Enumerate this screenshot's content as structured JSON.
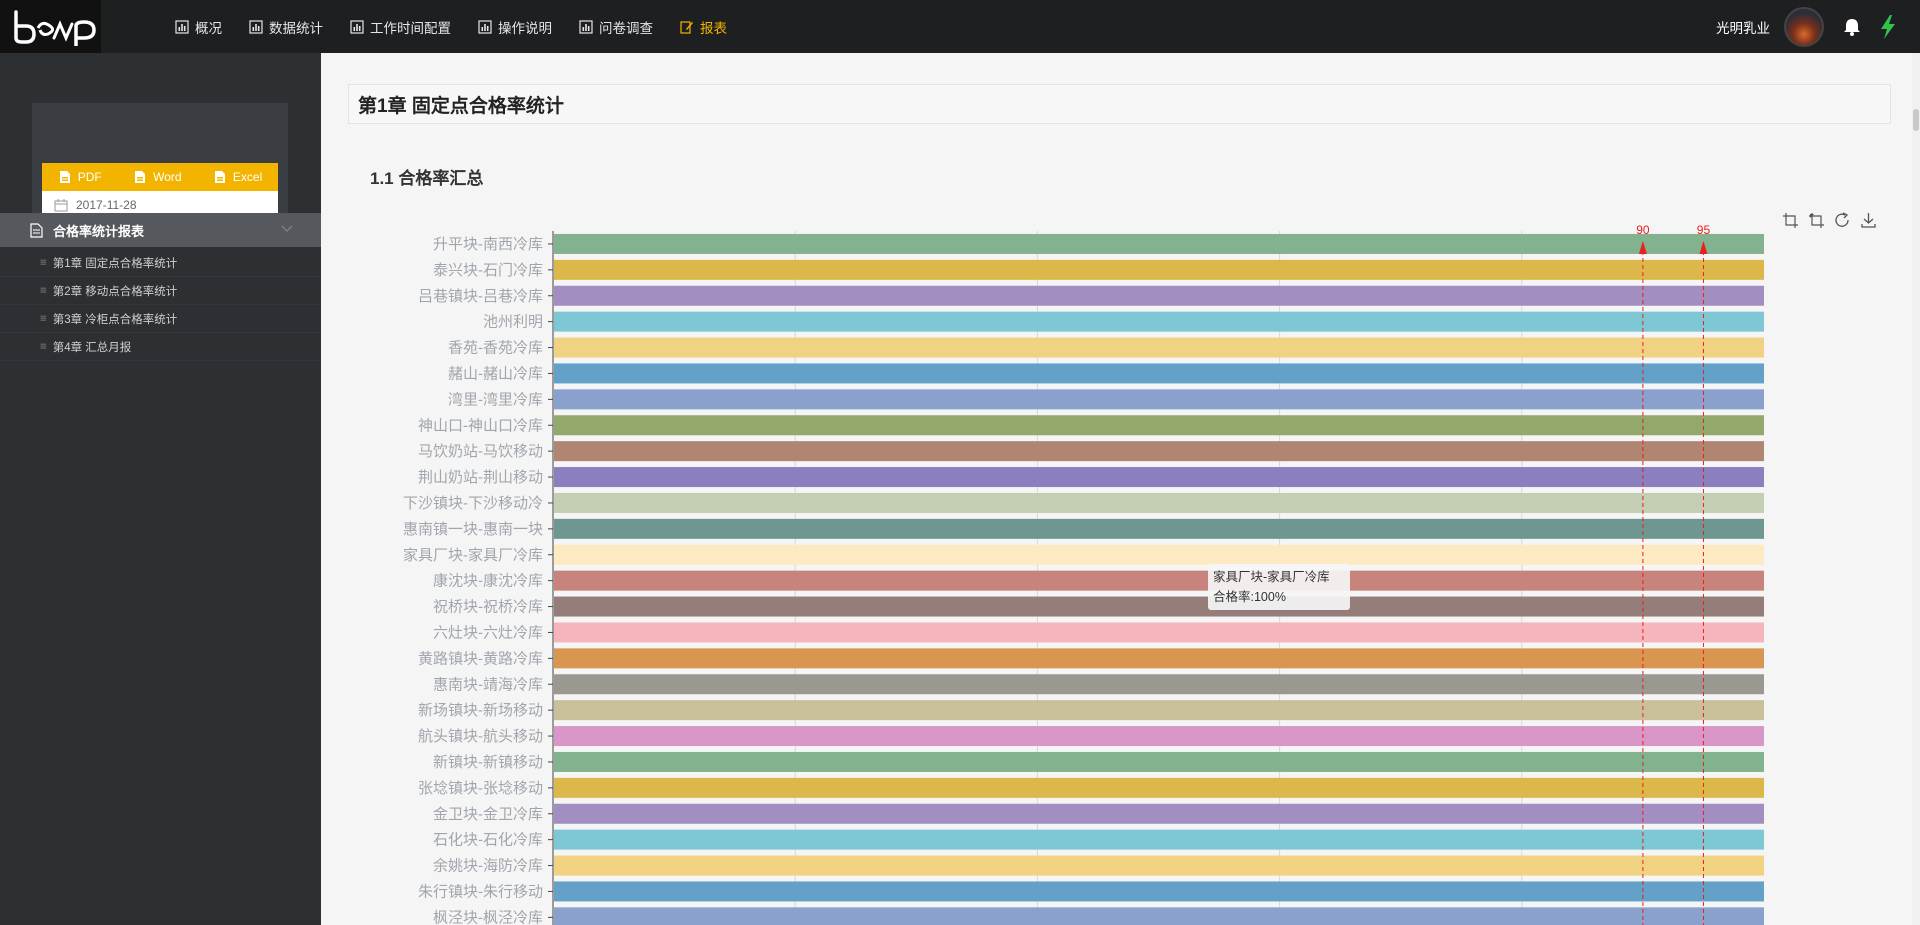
{
  "topbar": {
    "nav": [
      {
        "label": "概况",
        "icon": "chart-icon",
        "active": false
      },
      {
        "label": "数据统计",
        "icon": "chart-icon",
        "active": false
      },
      {
        "label": "工作时间配置",
        "icon": "chart-icon",
        "active": false
      },
      {
        "label": "操作说明",
        "icon": "chart-icon",
        "active": false
      },
      {
        "label": "问卷调查",
        "icon": "chart-icon",
        "active": false
      },
      {
        "label": "报表",
        "icon": "edit-icon",
        "active": true
      }
    ],
    "user_name": "光明乳业",
    "accent": "#f3b400"
  },
  "sidebar": {
    "export": {
      "pdf": "PDF",
      "word": "Word",
      "excel": "Excel"
    },
    "date": "2017-11-28",
    "menu_title": "合格率统计报表",
    "items": [
      {
        "label": "第1章 固定点合格率统计"
      },
      {
        "label": "第2章 移动点合格率统计"
      },
      {
        "label": "第3章 冷柜点合格率统计"
      },
      {
        "label": "第4章 汇总月报"
      }
    ]
  },
  "main": {
    "chapter_title": "第1章 固定点合格率统计",
    "section_title": "1.1 合格率汇总",
    "tooltip": {
      "title": "家具厂块-家具厂冷库",
      "value": "合格率:100%"
    }
  },
  "chart_data": {
    "type": "bar",
    "orientation": "horizontal",
    "categories": [
      "升平块-南西冷库",
      "泰兴块-石门冷库",
      "吕巷镇块-吕巷冷库",
      "池州利明",
      "香苑-香苑冷库",
      "赭山-赭山冷库",
      "湾里-湾里冷库",
      "神山口-神山口冷库",
      "马饮奶站-马饮移动",
      "荆山奶站-荆山移动",
      "下沙镇块-下沙移动冷",
      "惠南镇一块-惠南一块",
      "家具厂块-家具厂冷库",
      "康沈块-康沈冷库",
      "祝桥块-祝桥冷库",
      "六灶块-六灶冷库",
      "黄路镇块-黄路冷库",
      "惠南块-靖海冷库",
      "新场镇块-新场移动",
      "航头镇块-航头移动",
      "新镇块-新镇移动",
      "张埝镇块-张埝移动",
      "金卫块-金卫冷库",
      "石化块-石化冷库",
      "余姚块-海防冷库",
      "朱行镇块-朱行移动",
      "枫泾块-枫泾冷库"
    ],
    "values": [
      100,
      100,
      100,
      100,
      100,
      100,
      100,
      100,
      100,
      100,
      100,
      100,
      100,
      100,
      100,
      100,
      100,
      100,
      100,
      100,
      100,
      100,
      100,
      100,
      100,
      100,
      100
    ],
    "colors": [
      "#82b28e",
      "#dcb84a",
      "#a28ec0",
      "#7ec8d6",
      "#f1d283",
      "#63a1c8",
      "#8aa1cd",
      "#93a86b",
      "#b08672",
      "#8b7fbf",
      "#c3ceb3",
      "#6f9791",
      "#fde9c2",
      "#c8847c",
      "#957d7a",
      "#f6b5bd",
      "#d99650",
      "#9b9891",
      "#c9bf9b",
      "#d996c8",
      "#82b28e",
      "#dcb84a",
      "#a28ec0",
      "#7ec8d6",
      "#f1d283",
      "#63a1c8",
      "#8aa1cd"
    ],
    "markLines": [
      90,
      95
    ],
    "markLineColor": "#e8211d",
    "xlim": [
      0,
      100
    ],
    "gridLines": [
      20,
      40,
      60,
      80
    ]
  }
}
